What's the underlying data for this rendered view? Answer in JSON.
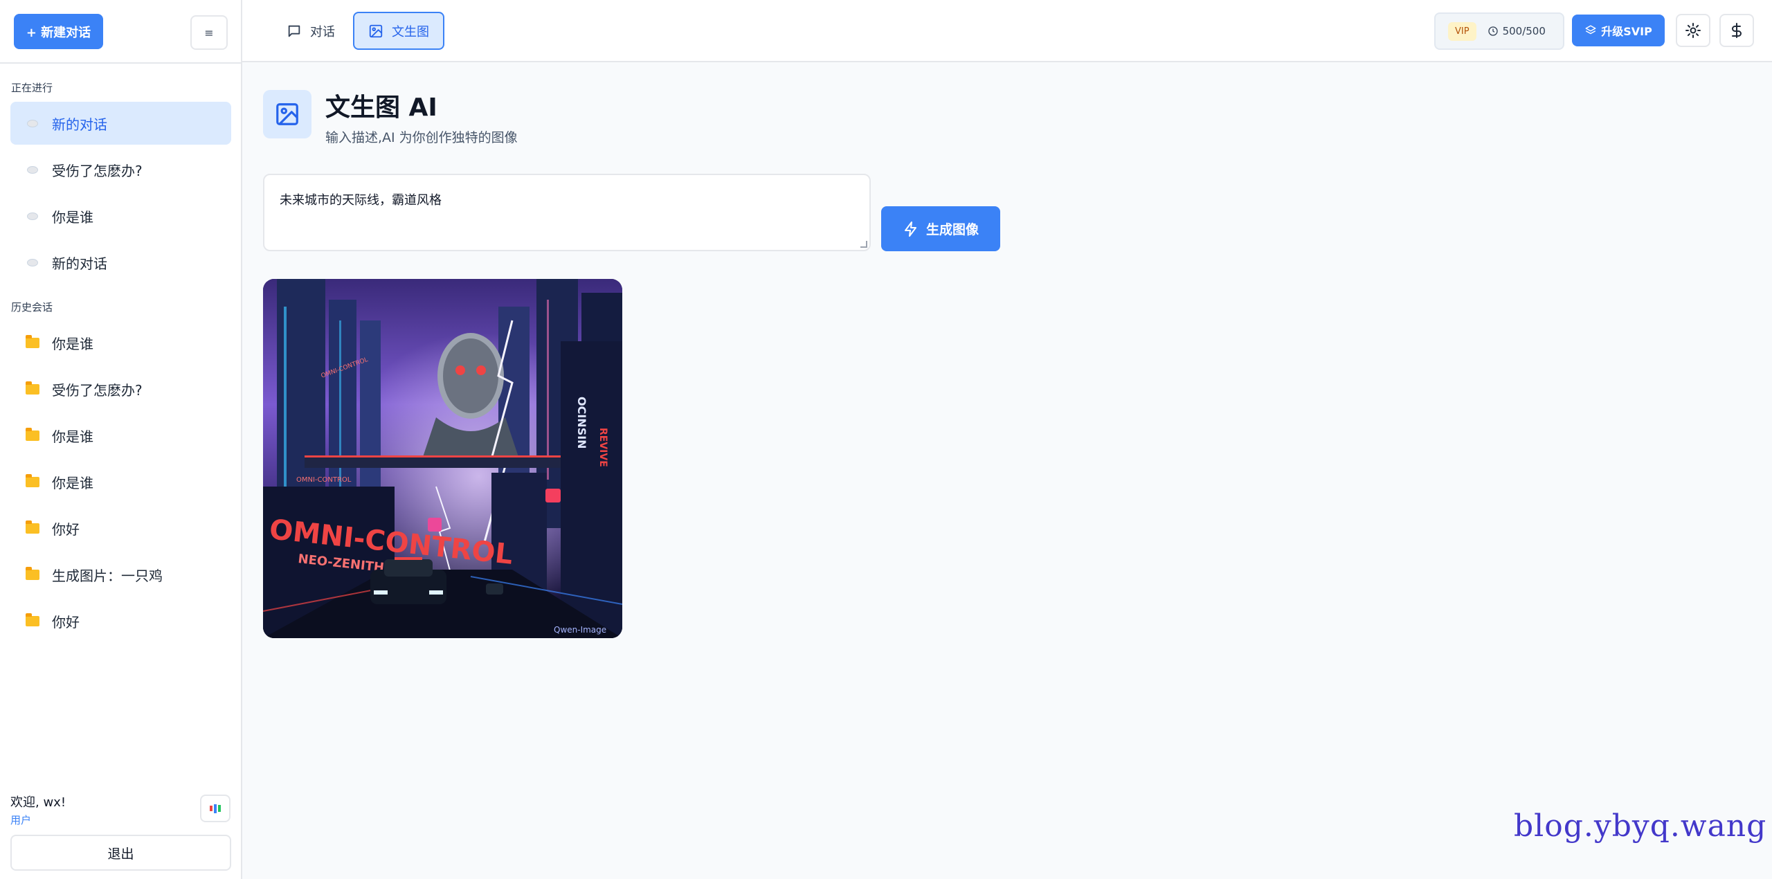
{
  "sidebar": {
    "new_chat_label": "+ 新建对话",
    "menu_label": "≡",
    "active_section_title": "正在进行",
    "active_items": [
      {
        "label": "新的对话"
      },
      {
        "label": "受伤了怎麽办?"
      },
      {
        "label": "你是谁"
      },
      {
        "label": "新的对话"
      }
    ],
    "history_section_title": "历史会话",
    "history_items": [
      {
        "label": "你是谁"
      },
      {
        "label": "受伤了怎麽办?"
      },
      {
        "label": "你是谁"
      },
      {
        "label": "你是谁"
      },
      {
        "label": "你好"
      },
      {
        "label": "生成图片：一只鸡"
      },
      {
        "label": "你好"
      }
    ],
    "welcome": "欢迎, wx!",
    "role": "用户",
    "logout_label": "退出"
  },
  "topbar": {
    "tabs": [
      {
        "label": "对话",
        "icon": "chat-icon"
      },
      {
        "label": "文生图",
        "icon": "image-icon"
      }
    ],
    "vip_badge": "VIP",
    "quota": "500/500",
    "upgrade_label": "升级SVIP"
  },
  "main": {
    "title": "文生图 AI",
    "subtitle": "输入描述,AI 为你创作独特的图像",
    "prompt_value": "未来城市的天际线，霸道风格",
    "generate_label": "生成图像",
    "image": {
      "sign_main": "OMNI-CONTROL",
      "sign_sub": "NEO-ZENITH",
      "sign_small": "OMNI-CONTROL",
      "sign_small_2": "OMNI-CONTROL",
      "vertical_sign": "OCINSIN",
      "vertical_sign_2": "REVIVE",
      "logo_text": "Qwen-Image"
    }
  },
  "watermark": "blog.ybyq.wang",
  "colors": {
    "primary": "#3b82f6",
    "active_bg": "#dbeafe",
    "border": "#e5e7eb"
  }
}
